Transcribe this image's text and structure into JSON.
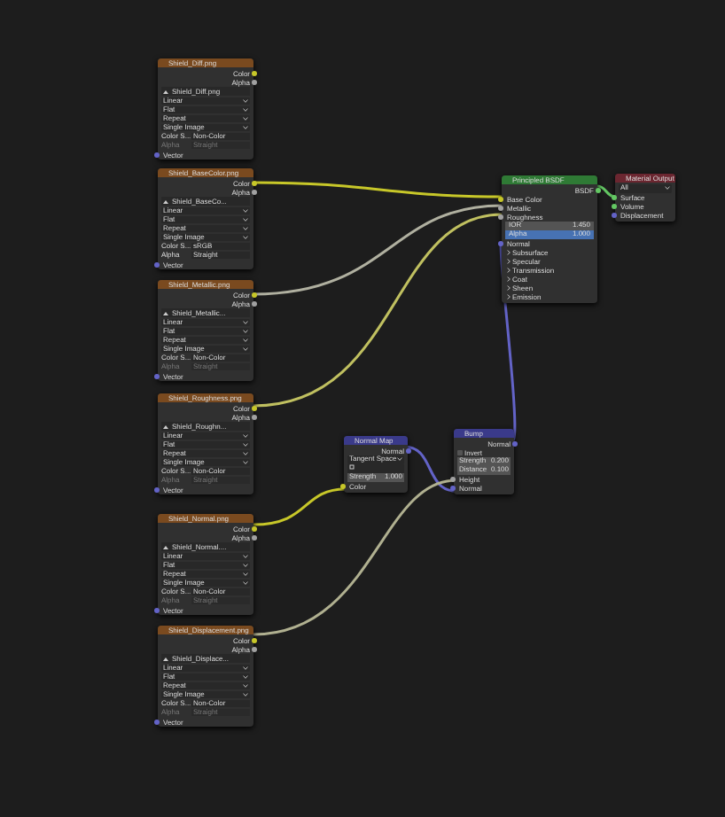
{
  "image_nodes": [
    {
      "title": "Shield_Diff.png",
      "outputs": [
        {
          "label": "Color",
          "kind": "color"
        },
        {
          "label": "Alpha",
          "kind": "float"
        }
      ],
      "image_name": "Shield_Diff.png",
      "options": [
        "Linear",
        "Flat",
        "Repeat",
        "Single Image"
      ],
      "color_space_label": "Color S...",
      "color_space": "Non-Color",
      "alpha_label": "Alpha",
      "alpha_mode": "Straight",
      "alpha_disabled": true,
      "input": {
        "label": "Vector",
        "kind": "vector"
      }
    },
    {
      "title": "Shield_BaseColor.png",
      "outputs": [
        {
          "label": "Color",
          "kind": "color"
        },
        {
          "label": "Alpha",
          "kind": "float"
        }
      ],
      "image_name": "Shield_BaseCo...",
      "options": [
        "Linear",
        "Flat",
        "Repeat",
        "Single Image"
      ],
      "color_space_label": "Color S...",
      "color_space": "sRGB",
      "alpha_label": "Alpha",
      "alpha_mode": "Straight",
      "alpha_disabled": false,
      "input": {
        "label": "Vector",
        "kind": "vector"
      }
    },
    {
      "title": "Shield_Metallic.png",
      "outputs": [
        {
          "label": "Color",
          "kind": "color"
        },
        {
          "label": "Alpha",
          "kind": "float"
        }
      ],
      "image_name": "Shield_Metallic...",
      "options": [
        "Linear",
        "Flat",
        "Repeat",
        "Single Image"
      ],
      "color_space_label": "Color S...",
      "color_space": "Non-Color",
      "alpha_label": "Alpha",
      "alpha_mode": "Straight",
      "alpha_disabled": true,
      "input": {
        "label": "Vector",
        "kind": "vector"
      }
    },
    {
      "title": "Shield_Roughness.png",
      "outputs": [
        {
          "label": "Color",
          "kind": "color"
        },
        {
          "label": "Alpha",
          "kind": "float"
        }
      ],
      "image_name": "Shield_Roughn...",
      "options": [
        "Linear",
        "Flat",
        "Repeat",
        "Single Image"
      ],
      "color_space_label": "Color S...",
      "color_space": "Non-Color",
      "alpha_label": "Alpha",
      "alpha_mode": "Straight",
      "alpha_disabled": true,
      "input": {
        "label": "Vector",
        "kind": "vector"
      }
    },
    {
      "title": "Shield_Normal.png",
      "outputs": [
        {
          "label": "Color",
          "kind": "color"
        },
        {
          "label": "Alpha",
          "kind": "float"
        }
      ],
      "image_name": "Shield_Normal....",
      "options": [
        "Linear",
        "Flat",
        "Repeat",
        "Single Image"
      ],
      "color_space_label": "Color S...",
      "color_space": "Non-Color",
      "alpha_label": "Alpha",
      "alpha_mode": "Straight",
      "alpha_disabled": true,
      "input": {
        "label": "Vector",
        "kind": "vector"
      }
    },
    {
      "title": "Shield_Displacement.png",
      "outputs": [
        {
          "label": "Color",
          "kind": "color"
        },
        {
          "label": "Alpha",
          "kind": "float"
        }
      ],
      "image_name": "Shield_Displace...",
      "options": [
        "Linear",
        "Flat",
        "Repeat",
        "Single Image"
      ],
      "color_space_label": "Color S...",
      "color_space": "Non-Color",
      "alpha_label": "Alpha",
      "alpha_mode": "Straight",
      "alpha_disabled": true,
      "input": {
        "label": "Vector",
        "kind": "vector"
      }
    }
  ],
  "principled": {
    "title": "Principled BSDF",
    "output": {
      "label": "BSDF",
      "kind": "shader"
    },
    "inputs": [
      {
        "label": "Base Color",
        "kind": "color"
      },
      {
        "label": "Metallic",
        "kind": "float"
      },
      {
        "label": "Roughness",
        "kind": "float"
      }
    ],
    "fields": [
      {
        "label": "IOR",
        "value": "1.450",
        "selected": false
      },
      {
        "label": "Alpha",
        "value": "1.000",
        "selected": true
      }
    ],
    "normal": {
      "label": "Normal",
      "kind": "vector"
    },
    "panels": [
      "Subsurface",
      "Specular",
      "Transmission",
      "Coat",
      "Sheen",
      "Emission"
    ]
  },
  "material_output": {
    "title": "Material Output",
    "target": "All",
    "inputs": [
      {
        "label": "Surface",
        "kind": "shader"
      },
      {
        "label": "Volume",
        "kind": "shader"
      },
      {
        "label": "Displacement",
        "kind": "vector"
      }
    ]
  },
  "normal_map": {
    "title": "Normal Map",
    "output": {
      "label": "Normal",
      "kind": "vector"
    },
    "space": "Tangent Space",
    "strength": {
      "label": "Strength",
      "value": "1.000",
      "selected": false
    },
    "input": {
      "label": "Color",
      "kind": "color"
    }
  },
  "bump": {
    "title": "Bump",
    "output": {
      "label": "Normal",
      "kind": "vector"
    },
    "invert": {
      "label": "Invert",
      "checked": false
    },
    "fields": [
      {
        "label": "Strength",
        "value": "0.200",
        "selected": false
      },
      {
        "label": "Distance",
        "value": "0.100",
        "selected": false
      }
    ],
    "inputs": [
      {
        "label": "Height",
        "kind": "float"
      },
      {
        "label": "Normal",
        "kind": "vector"
      }
    ]
  }
}
